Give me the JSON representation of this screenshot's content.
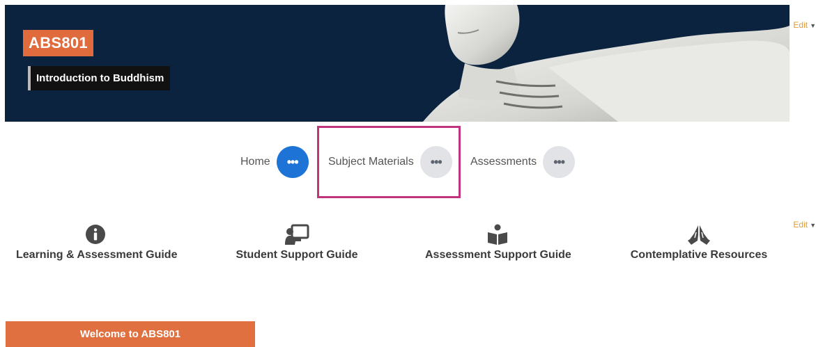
{
  "banner": {
    "course_code": "ABS801",
    "course_title": "Introduction to Buddhism"
  },
  "edit": {
    "label": "Edit"
  },
  "nav": {
    "items": [
      {
        "label": "Home",
        "menu_icon": "ellipsis-icon"
      },
      {
        "label": "Subject Materials",
        "menu_icon": "ellipsis-icon"
      },
      {
        "label": "Assessments",
        "menu_icon": "ellipsis-icon"
      }
    ]
  },
  "guides": [
    {
      "label": "Learning & Assessment Guide",
      "icon": "info-circle-icon"
    },
    {
      "label": "Student Support Guide",
      "icon": "teacher-board-icon"
    },
    {
      "label": "Assessment Support Guide",
      "icon": "reader-book-icon"
    },
    {
      "label": "Contemplative Resources",
      "icon": "praying-hands-icon"
    }
  ],
  "welcome": {
    "label": "Welcome to ABS801"
  },
  "colors": {
    "brand_orange": "#e06b3d",
    "active_blue": "#1d74d6",
    "highlight_magenta": "#c0347e",
    "edit_orange": "#e69a2e",
    "banner_navy": "#0c2340"
  }
}
